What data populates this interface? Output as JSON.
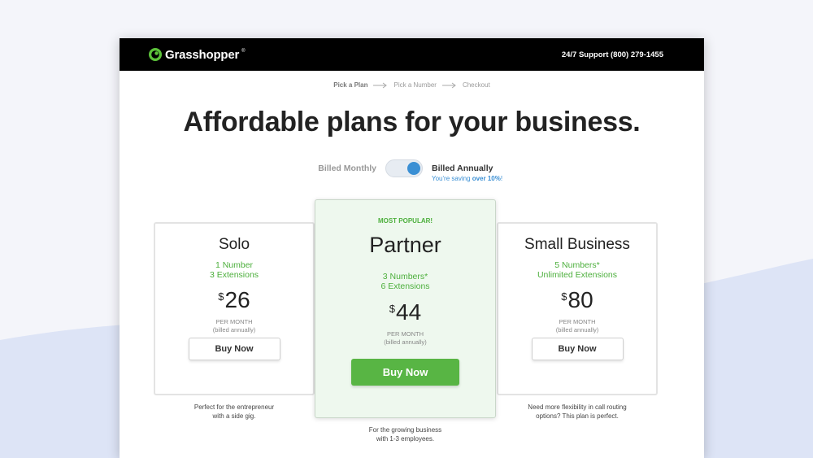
{
  "brand": {
    "name": "Grasshopper",
    "trademark": "®",
    "logo_icon": "grasshopper-logo-icon"
  },
  "support_text": "24/7 Support (800) 279-1455",
  "steps": [
    {
      "label": "Pick a Plan",
      "active": true
    },
    {
      "label": "Pick a Number",
      "active": false
    },
    {
      "label": "Checkout",
      "active": false
    }
  ],
  "headline": "Affordable plans for your business.",
  "billing": {
    "monthly_label": "Billed Monthly",
    "annual_label": "Billed Annually",
    "saving_prefix": "You're saving ",
    "saving_amount": "over 10%",
    "saving_suffix": "!",
    "annual_selected": true
  },
  "plans": [
    {
      "name": "Solo",
      "features": [
        "1 Number",
        "3 Extensions"
      ],
      "currency": "$",
      "price": "26",
      "per": [
        "PER MONTH",
        "(billed annually)"
      ],
      "button": "Buy Now",
      "description": [
        "Perfect for the entrepreneur",
        "with a side gig."
      ]
    },
    {
      "badge": "MOST POPULAR!",
      "name": "Partner",
      "features": [
        "3 Numbers*",
        "6 Extensions"
      ],
      "currency": "$",
      "price": "44",
      "per": [
        "PER MONTH",
        "(billed annually)"
      ],
      "button": "Buy Now",
      "description": [
        "For the growing business",
        "with 1-3 employees."
      ]
    },
    {
      "name": "Small Business",
      "features": [
        "5 Numbers*",
        "Unlimited Extensions"
      ],
      "currency": "$",
      "price": "80",
      "per": [
        "PER MONTH",
        "(billed annually)"
      ],
      "button": "Buy Now",
      "description": [
        "Need more flexibility in call routing",
        "options? This plan is perfect."
      ]
    }
  ],
  "colors": {
    "accent_green": "#58b544",
    "feature_green": "#4caf3c",
    "toggle_blue": "#3a8fd4",
    "topbar": "#000000",
    "background_wave": "#dde4f6"
  }
}
